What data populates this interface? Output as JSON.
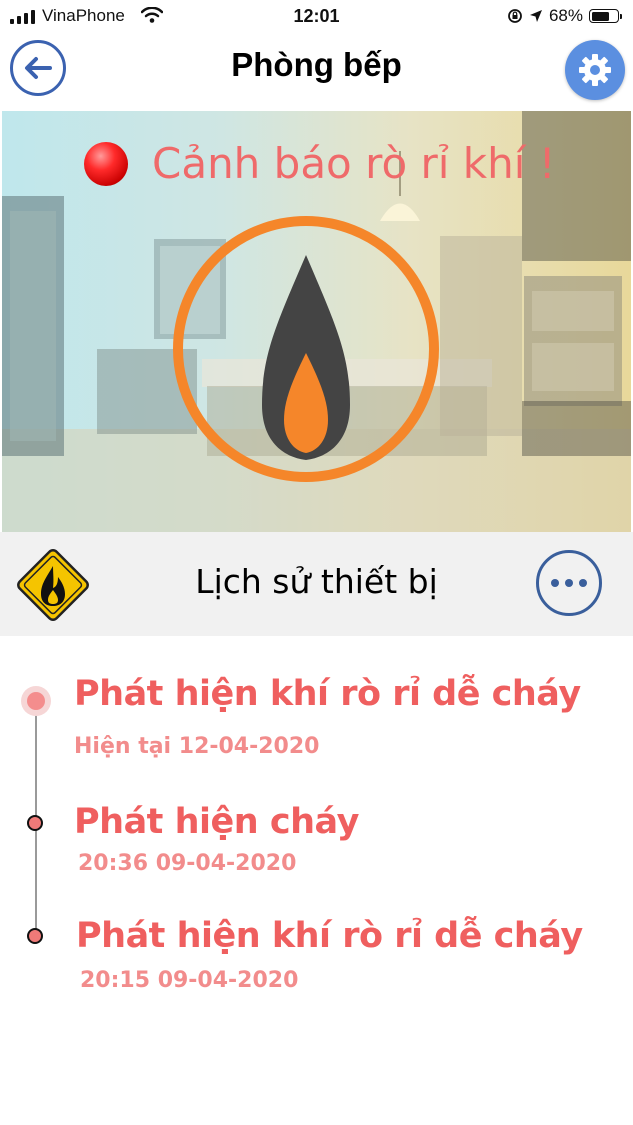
{
  "status_bar": {
    "carrier": "VinaPhone",
    "time": "12:01",
    "battery_percent": "68%",
    "battery_level": 0.68
  },
  "header": {
    "title": "Phòng bếp",
    "back_icon": "arrow-left-icon",
    "settings_icon": "gear-icon"
  },
  "hero": {
    "alert_text": "Cảnh báo rò rỉ khí !",
    "icon": "gas-flame-icon",
    "colors": {
      "ring": "#f5862a",
      "flame_outer": "#444444",
      "flame_inner": "#f5862a",
      "alert": "#ef6a6a"
    }
  },
  "history": {
    "title": "Lịch sử thiết bị",
    "sign_icon": "fire-warning-sign-icon",
    "more_icon": "more-dots-icon"
  },
  "events": [
    {
      "title": "Phát hiện khí rò rỉ dễ cháy",
      "date": "Hiện tại 12-04-2020"
    },
    {
      "title": "Phát hiện cháy",
      "date": "20:36 09-04-2020"
    },
    {
      "title": "Phát hiện khí rò rỉ dễ cháy",
      "date": "20:15 09-04-2020"
    }
  ]
}
